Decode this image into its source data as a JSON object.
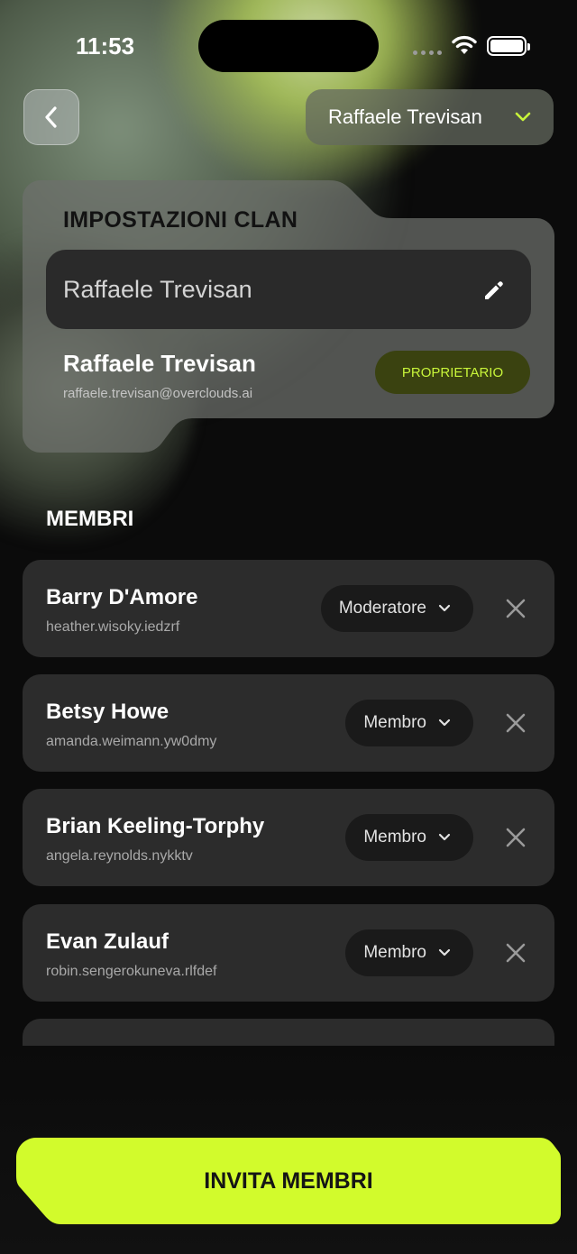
{
  "status_bar": {
    "time": "11:53"
  },
  "header": {
    "back_icon": "chevron-left-icon",
    "account_selector": {
      "selected": "Raffaele Trevisan",
      "icon": "chevron-down-icon"
    }
  },
  "clan_settings": {
    "title": "IMPOSTAZIONI CLAN",
    "name_field": {
      "value": "Raffaele Trevisan",
      "icon": "pencil-icon"
    },
    "owner": {
      "name": "Raffaele Trevisan",
      "email": "raffaele.trevisan@overclouds.ai",
      "role_badge": "PROPRIETARIO"
    }
  },
  "members": {
    "title": "MEMBRI",
    "items": [
      {
        "name": "Barry D'Amore",
        "handle": "heather.wisoky.iedzrf",
        "role": "Moderatore"
      },
      {
        "name": "Betsy Howe",
        "handle": "amanda.weimann.yw0dmy",
        "role": "Membro"
      },
      {
        "name": "Brian Keeling-Torphy",
        "handle": "angela.reynolds.nykktv",
        "role": "Membro"
      },
      {
        "name": "Evan Zulauf",
        "handle": "robin.sengerokuneva.rlfdef",
        "role": "Membro"
      }
    ]
  },
  "invite_button": {
    "label": "INVITA MEMBRI"
  },
  "colors": {
    "accent": "#c8f53a",
    "card": "#2c2c2c",
    "badge_bg": "#3a4210"
  }
}
